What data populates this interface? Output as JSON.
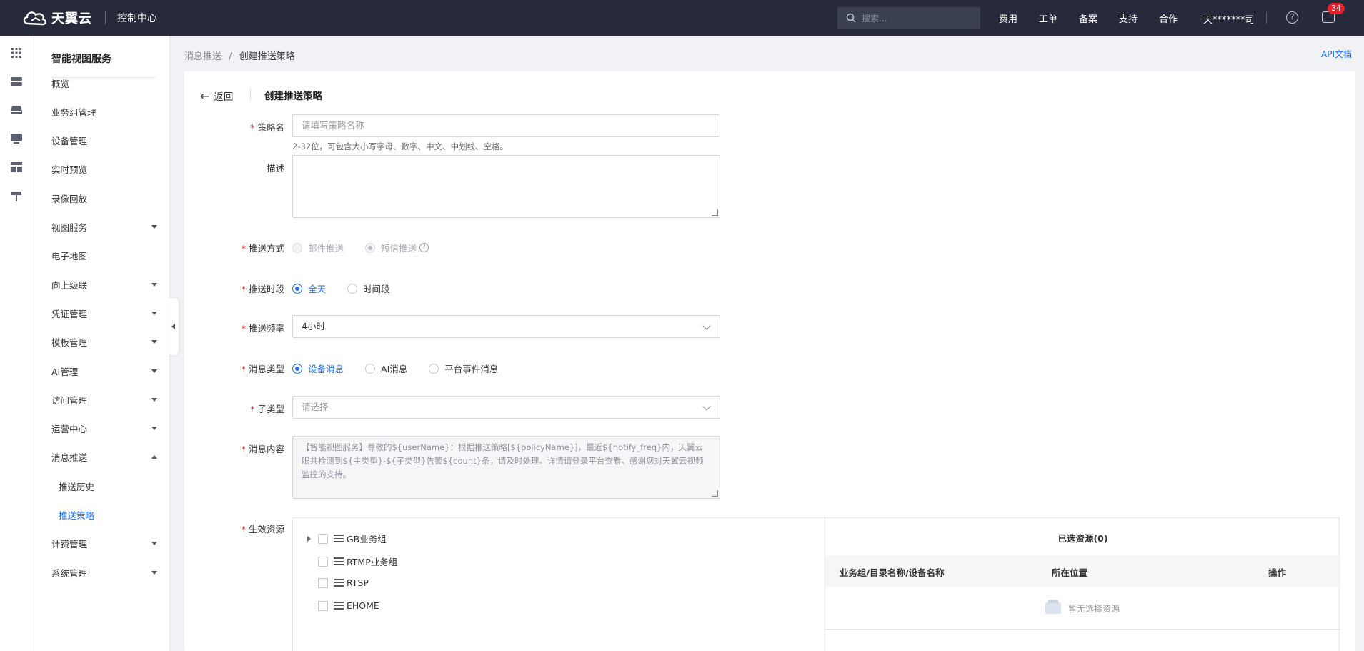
{
  "topbar": {
    "brand": "天翼云",
    "console": "控制中心",
    "search_placeholder": "搜索...",
    "nav": [
      "费用",
      "工单",
      "备案",
      "支持",
      "合作"
    ],
    "user": "天*******司",
    "message_count": "34"
  },
  "sidebar": {
    "title": "智能视图服务",
    "items": [
      {
        "label": "概览",
        "caret": ""
      },
      {
        "label": "业务组管理",
        "caret": ""
      },
      {
        "label": "设备管理",
        "caret": ""
      },
      {
        "label": "实时预览",
        "caret": ""
      },
      {
        "label": "录像回放",
        "caret": ""
      },
      {
        "label": "视图服务",
        "caret": "down"
      },
      {
        "label": "电子地图",
        "caret": ""
      },
      {
        "label": "向上级联",
        "caret": "down"
      },
      {
        "label": "凭证管理",
        "caret": "down"
      },
      {
        "label": "模板管理",
        "caret": "down"
      },
      {
        "label": "AI管理",
        "caret": "down"
      },
      {
        "label": "访问管理",
        "caret": "down"
      },
      {
        "label": "运营中心",
        "caret": "down"
      },
      {
        "label": "消息推送",
        "caret": "up"
      },
      {
        "label": "推送历史",
        "caret": "",
        "sub": true
      },
      {
        "label": "推送策略",
        "caret": "",
        "sub": true,
        "active": true
      },
      {
        "label": "计费管理",
        "caret": "down"
      },
      {
        "label": "系统管理",
        "caret": "down"
      }
    ]
  },
  "breadcrumb": {
    "parent": "消息推送",
    "sep": "/",
    "current": "创建推送策略"
  },
  "api_doc": "API文档",
  "header": {
    "back": "返回",
    "title": "创建推送策略"
  },
  "form": {
    "policy_name": {
      "label": "策略名",
      "placeholder": "请填写策略名称",
      "hint": "2-32位，可包含大小写字母、数字、中文、中划线、空格。"
    },
    "description": {
      "label": "描述"
    },
    "push_method": {
      "label": "推送方式",
      "options": [
        "邮件推送",
        "短信推送"
      ],
      "selected": "短信推送"
    },
    "push_period": {
      "label": "推送时段",
      "options": [
        "全天",
        "时间段"
      ],
      "selected": "全天"
    },
    "push_frequency": {
      "label": "推送频率",
      "value": "4小时"
    },
    "message_type": {
      "label": "消息类型",
      "options": [
        "设备消息",
        "AI消息",
        "平台事件消息"
      ],
      "selected": "设备消息"
    },
    "sub_type": {
      "label": "子类型",
      "placeholder": "请选择"
    },
    "message_content": {
      "label": "消息内容",
      "value": "【智能视图服务】尊敬的${userName}：根据推送策略[${policyName}]，最近${notify_freq}内，天翼云眼共检测到${主类型}-${子类型}告警${count}条，请及时处理。详情请登录平台查看。感谢您对天翼云视频监控的支持。"
    },
    "resources": {
      "label": "生效资源",
      "tree": [
        "GB业务组",
        "RTMP业务组",
        "RTSP",
        "EHOME"
      ],
      "selected_title": "已选资源(0)",
      "columns": [
        "业务组/目录名称/设备名称",
        "所在位置",
        "操作"
      ],
      "empty_text": "暂无选择资源"
    }
  },
  "colors": {
    "accent": "#1f6ff2",
    "topbar": "#262a3a",
    "required": "#e6212a"
  }
}
